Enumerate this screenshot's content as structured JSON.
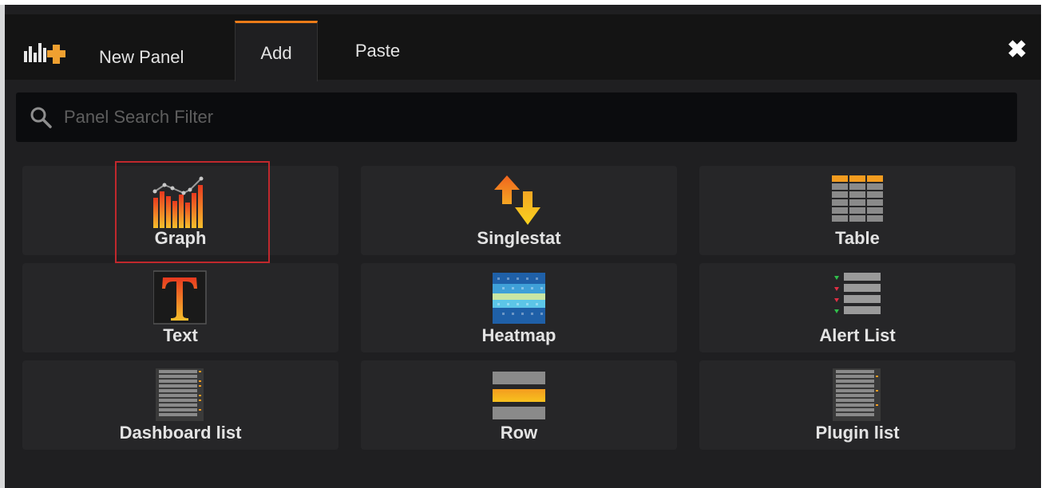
{
  "header": {
    "title": "New Panel",
    "tabs": [
      "Add",
      "Paste"
    ],
    "close_icon": "close-icon"
  },
  "search": {
    "placeholder": "Panel Search Filter",
    "value": ""
  },
  "panels": [
    {
      "label": "Graph",
      "icon": "graph-icon"
    },
    {
      "label": "Singlestat",
      "icon": "singlestat-icon"
    },
    {
      "label": "Table",
      "icon": "table-icon"
    },
    {
      "label": "Text",
      "icon": "text-icon"
    },
    {
      "label": "Heatmap",
      "icon": "heatmap-icon"
    },
    {
      "label": "Alert List",
      "icon": "alert-list-icon"
    },
    {
      "label": "Dashboard list",
      "icon": "dashboard-list-icon"
    },
    {
      "label": "Row",
      "icon": "row-icon"
    },
    {
      "label": "Plugin list",
      "icon": "plugin-list-icon"
    }
  ],
  "colors": {
    "accent": "#eb7b18",
    "selection": "#c0282d"
  }
}
